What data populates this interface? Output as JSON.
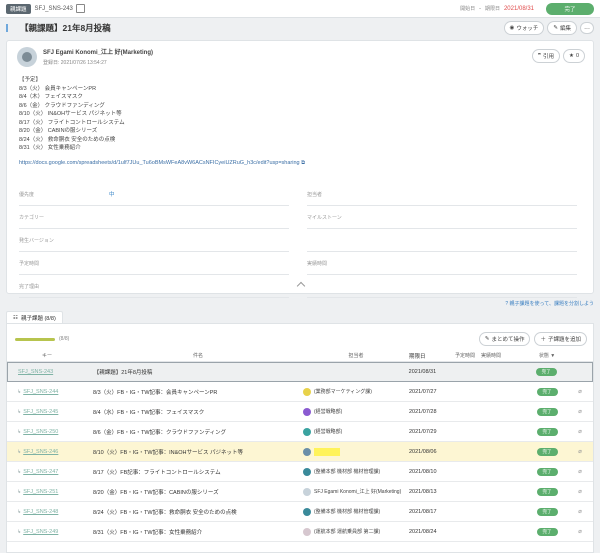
{
  "topbar": {
    "parent_badge": "親課題",
    "task_key": "SFJ_SNS-243",
    "start_label": "開始日",
    "start_value": "-",
    "due_label": "期限日",
    "due_value": "2021/08/31",
    "status": "完了"
  },
  "title": {
    "text": "【親課題】21年8月投稿",
    "watch_label": "ウォッチ",
    "edit_label": "編集",
    "more_label": "..."
  },
  "description": {
    "author": "SFJ Egami Konomi_江上 好(Marketing)",
    "date": "登録日: 2021/07/26 13:54:27",
    "quote_label": "引用",
    "star_count": "0",
    "lines": [
      "【予定】",
      "8/3（火） 会員キャンペーンPR",
      "8/4（木） フェイスマスク",
      "8/6（金） クラウドファンディング",
      "8/10（火） IN&OHサービス パジネット等",
      "8/17（火） フライトコントロールシステム",
      "8/20（金） CABINの服シリーズ",
      "8/24（火） 救命胴衣 安全のための点検",
      "8/31（火） 女性乗務紹介"
    ],
    "link": "https://docs.google.com/spreadsheets/d/1ulf7JUu_Tu6oBMsWFeA8vW6ACsNFICyeiUZRuG_h3c/edit?usp=sharing"
  },
  "fields": {
    "priority_label": "優先度",
    "priority_value": "中",
    "assignee_label": "担当者",
    "category_label": "カテゴリー",
    "milestone_label": "マイルストーン",
    "version_label": "発生バージョン",
    "planned_label": "予定時間",
    "actual_label": "実績時間",
    "resolution_label": "完了理由"
  },
  "hint": "親子課題を使って、課題を分割しよう",
  "subtasks": {
    "tab_label": "親子課題 (8/8)",
    "progress_text": "(8/8)",
    "progress_fraction": 1.0,
    "bulk_label": "まとめて操作",
    "add_label": "子課題を追加",
    "columns": {
      "key": "キー",
      "name": "件名",
      "assignee": "担当者",
      "due": "期限日",
      "planned": "予定時間",
      "actual": "実績時間",
      "status": "状態 ▼"
    },
    "rows": [
      {
        "key": "SFJ_SNS-243",
        "name": "【親課題】21年8月投稿",
        "assignee": "",
        "due": "2021/08/31",
        "status": "完了",
        "avatar_color": "",
        "type": "parent"
      },
      {
        "key": "SFJ_SNS-244",
        "name": "8/3（火）FB・IG・TW記事：会員キャンペーンPR",
        "assignee": "(業務部マーケティング課)",
        "due": "2021/07/27",
        "status": "完了",
        "avatar_color": "#e8d24a",
        "type": "child"
      },
      {
        "key": "SFJ_SNS-245",
        "name": "8/4（水）FB・IG・TW記事：フェイスマスク",
        "assignee": "(経営戦略部)",
        "due": "2021/07/28",
        "status": "完了",
        "avatar_color": "#8a5bd1",
        "type": "child"
      },
      {
        "key": "SFJ_SNS-250",
        "name": "8/6（金）FB・IG・TW記事：クラウドファンディング",
        "assignee": "(経営戦略部)",
        "due": "2021/07/29",
        "status": "完了",
        "avatar_color": "#3aa3a0",
        "type": "child"
      },
      {
        "key": "SFJ_SNS-246",
        "name": "8/10（火）FB・IG・TW記事：IN&OHサービス パジネット等",
        "assignee": "",
        "due": "2021/08/06",
        "status": "完了",
        "avatar_color": "#6b8fa8",
        "type": "highlight"
      },
      {
        "key": "SFJ_SNS-247",
        "name": "8/17（火）FB記事：フライトコントロールシステム",
        "assignee": "(整備本部 機材部 機材管理課)",
        "due": "2021/08/10",
        "status": "完了",
        "avatar_color": "#3a8a9a",
        "type": "child"
      },
      {
        "key": "SFJ_SNS-251",
        "name": "8/20（金）FB・IG・TW記事：CABINの服シリーズ",
        "assignee": "SFJ Egami Konomi_江上 好(Marketing)",
        "due": "2021/08/13",
        "status": "完了",
        "avatar_color": "#c7d2da",
        "type": "child"
      },
      {
        "key": "SFJ_SNS-248",
        "name": "8/24（火）FB・IG・TW記事：救命胴衣 安全のための点検",
        "assignee": "(整備本部 機材部 機材管理課)",
        "due": "2021/08/17",
        "status": "完了",
        "avatar_color": "#3a8a9a",
        "type": "child"
      },
      {
        "key": "SFJ_SNS-249",
        "name": "8/31（火）FB・IG・TW記事：女性乗務紹介",
        "assignee": "(運航本部 運航乗員部 第二課)",
        "due": "2021/08/24",
        "status": "完了",
        "avatar_color": "#d6c7cf",
        "type": "child"
      }
    ]
  }
}
